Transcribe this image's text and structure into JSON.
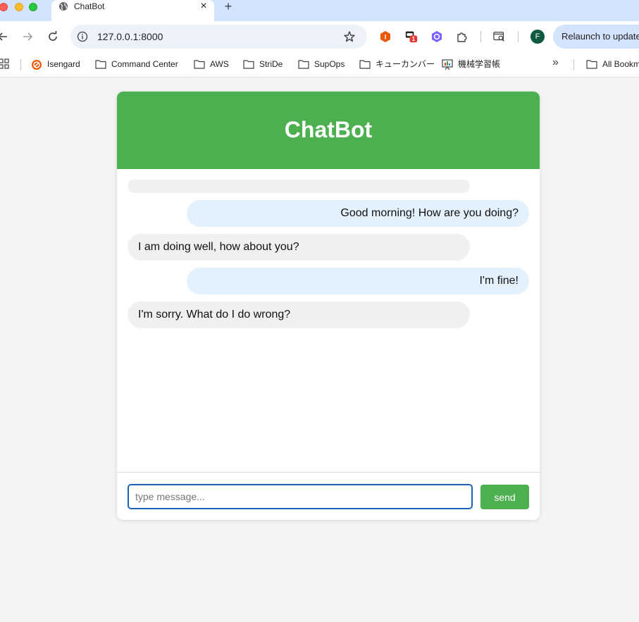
{
  "browser": {
    "tab": {
      "title": "ChatBot",
      "favicon": "globe-icon",
      "close_icon": "×",
      "new_tab_icon": "+"
    },
    "url": "127.0.0.1:8000",
    "extensions": [
      {
        "name": "hexagon-extension-icon",
        "color": "#e8590c",
        "letter": "I"
      },
      {
        "name": "chat-extension-icon",
        "badge": "1"
      },
      {
        "name": "shield-extension-icon",
        "color": "#7b61ff"
      },
      {
        "name": "puzzle-icon"
      },
      {
        "name": "search-tab-icon"
      }
    ],
    "profile_initial": "F",
    "relaunch_label": "Relaunch to update",
    "bookmarks": [
      {
        "label": "Isengard",
        "icon": "isengard-icon"
      },
      {
        "label": "Command Center",
        "icon": "folder-icon"
      },
      {
        "label": "AWS",
        "icon": "folder-icon"
      },
      {
        "label": "StriDe",
        "icon": "folder-icon"
      },
      {
        "label": "SupOps",
        "icon": "folder-icon"
      },
      {
        "label": "キューカンバー",
        "icon": "folder-icon"
      },
      {
        "label": "機械学習帳",
        "icon": "chart-board-icon"
      }
    ],
    "overflow_icon": "»",
    "all_bookmarks_label": "All Bookmarks"
  },
  "chat": {
    "title": "ChatBot",
    "messages": [
      {
        "sender": "bot",
        "text": ""
      },
      {
        "sender": "user",
        "text": "Good morning! How are you doing?"
      },
      {
        "sender": "bot",
        "text": "I am doing well, how about you?"
      },
      {
        "sender": "user",
        "text": "I'm fine!"
      },
      {
        "sender": "bot",
        "text": "I'm sorry. What do I do wrong?"
      }
    ],
    "input": {
      "value": "",
      "placeholder": "type message..."
    },
    "send_label": "send"
  },
  "colors": {
    "accent": "#4caf50",
    "user_bubble": "#e3f1fd",
    "bot_bubble": "#f0f0f0",
    "input_border": "#1a63b8"
  }
}
